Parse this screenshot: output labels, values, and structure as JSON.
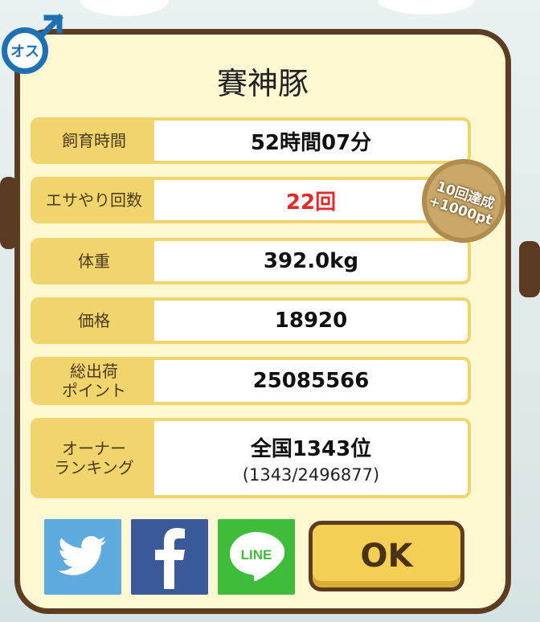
{
  "pig_name": "賽神豚",
  "gender_badge": "オス",
  "rows": [
    {
      "label": "飼育時間",
      "value": "52時間07分"
    },
    {
      "label": "エサやり回数",
      "value": "22回"
    },
    {
      "label": "体重",
      "value": "392.0kg"
    },
    {
      "label": "価格",
      "value": "18920"
    },
    {
      "label": "総出荷\nポイント",
      "value": "25085566"
    },
    {
      "label": "オーナー\nランキング",
      "value": "全国1343位",
      "sub": "(1343/2496877)"
    }
  ],
  "achievement_badge": {
    "line1": "10回達成",
    "line2": "+1000pt"
  },
  "buttons": {
    "twitter": "twitter-icon",
    "facebook": "facebook-icon",
    "line": "LINE",
    "ok": "OK"
  },
  "colors": {
    "panel_bg": "#fdf7d2",
    "border": "#5c3d22",
    "label_bg": "#f2d46c",
    "accent_red": "#e02a2a",
    "twitter": "#5ea9dd",
    "facebook": "#3b5998",
    "line": "#3fbd3a",
    "ok_button": "#f3cf55"
  }
}
